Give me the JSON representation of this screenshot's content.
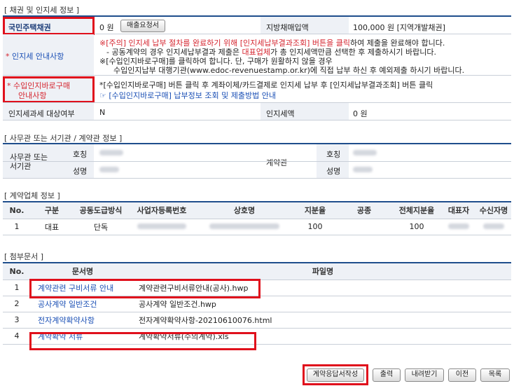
{
  "section1": {
    "title": "[ 채권 및 인지세 정보 ]",
    "row1": {
      "label": "국민주택채권",
      "value": "0 원",
      "btn": "매출요청서",
      "label2": "지방채매입액",
      "value2": "100,000 원  [지역개발채권]"
    },
    "row2": {
      "label": "인지세 안내사항",
      "line1a": "※[주의] 인지세 납부 절차를 완료하기 위해 ",
      "line1red": "[인지세납부결과조회] 버튼을 클릭",
      "line1b": "하여 제출을 완료해야 합니다.",
      "line2a": "- 공동계약의 경우 인지세납부결과 제출은 ",
      "line2red": "대표업체",
      "line2b": "가 총 인지세액만큼 선택한 후 제출하시기 바랍니다.",
      "line3": "※[수입인지바로구매]를 클릭하여 합니다. 단, 구매가 원활하지 않을 경우",
      "line4": "수입인지납부 대행기관(www.edoc-revenuestamp.or.kr)에 직접 납부 하신 후 예외제출 하시기 바랍니다."
    },
    "row3": {
      "label1": "수입인지바로구매",
      "label2": "안내사항",
      "line1": "*[수입인지바로구매] 버튼 클릭 후 계좌이체/카드결제로 인지세 납부 후 [인지세납부결과조회] 버튼 클릭",
      "line2": "☞ [수입인지바로구매] 납부정보 조회 및 제출방법 안내"
    },
    "row4": {
      "label": "인지세과세 대상여부",
      "value": "N",
      "label2": "인지세액",
      "value2": "0 원"
    }
  },
  "section2": {
    "title": "[ 사무관 또는 서기관 / 계약관 정보 ]",
    "left_label_line1": "사무관 또는",
    "left_label_line2": "서기관",
    "right_label": "계약관",
    "sub1": "호칭",
    "sub2": "성명"
  },
  "section3": {
    "title": "[ 계약업체 정보 ]",
    "headers": [
      "No.",
      "구분",
      "공동도급방식",
      "사업자등록번호",
      "상호명",
      "지분율",
      "공종",
      "전체지분율",
      "대표자",
      "수신자명"
    ],
    "row": {
      "no": "1",
      "type": "대표",
      "method": "단독",
      "share": "100",
      "total": "100"
    }
  },
  "section4": {
    "title": "[ 첨부문서 ]",
    "headers": [
      "No.",
      "문서명",
      "파일명"
    ],
    "rows": [
      {
        "no": "1",
        "doc": "계약관련 구비서류 안내",
        "file": "계약관련구비서류안내(공사).hwp"
      },
      {
        "no": "2",
        "doc": "공사계약 일반조건",
        "file": "공사계약 일반조건.hwp"
      },
      {
        "no": "3",
        "doc": "전자계약확약사항",
        "file": "전자계약확약사항-20210610076.html"
      },
      {
        "no": "4",
        "doc": "계약확약 서류",
        "file": "계약확약서류(수의계약).xls"
      }
    ]
  },
  "buttons": {
    "create": "계약응답서작성",
    "print": "출력",
    "download": "내려받기",
    "prev": "이전",
    "list": "목록"
  }
}
